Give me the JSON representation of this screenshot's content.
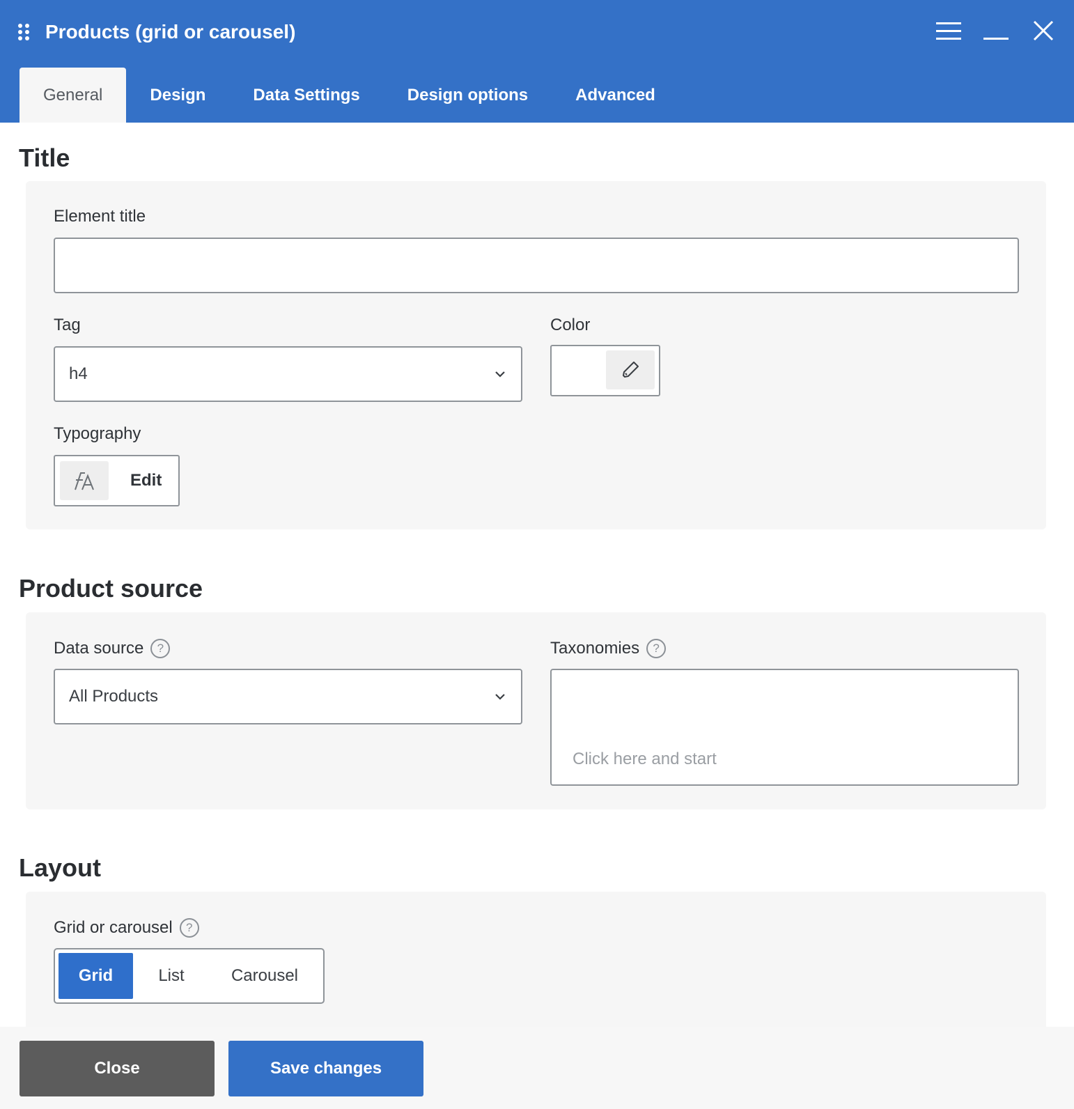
{
  "window": {
    "title": "Products (grid or carousel)",
    "icons": {
      "drag": "drag-handle-icon",
      "menu": "hamburger-menu-icon",
      "minimize": "minimize-icon",
      "close": "close-icon"
    }
  },
  "tabs": [
    {
      "label": "General",
      "active": true
    },
    {
      "label": "Design",
      "active": false
    },
    {
      "label": "Data Settings",
      "active": false
    },
    {
      "label": "Design options",
      "active": false
    },
    {
      "label": "Advanced",
      "active": false
    }
  ],
  "sections": {
    "title": {
      "heading": "Title",
      "element_title": {
        "label": "Element title",
        "value": ""
      },
      "tag": {
        "label": "Tag",
        "value": "h4"
      },
      "color": {
        "label": "Color",
        "icon": "eyedropper-icon"
      },
      "typography": {
        "label": "Typography",
        "button_label": "Edit",
        "icon": "font-typography-icon"
      }
    },
    "product_source": {
      "heading": "Product source",
      "data_source": {
        "label": "Data source",
        "value": "All Products",
        "help": "?"
      },
      "taxonomies": {
        "label": "Taxonomies",
        "placeholder": "Click here and start",
        "help": "?"
      }
    },
    "layout": {
      "heading": "Layout",
      "grid_or_carousel": {
        "label": "Grid or carousel",
        "help": "?",
        "options": [
          "Grid",
          "List",
          "Carousel"
        ],
        "selected": "Grid"
      }
    }
  },
  "footer": {
    "close_label": "Close",
    "save_label": "Save changes"
  },
  "colors": {
    "primary": "#3471c7",
    "panel_bg": "#f6f6f6",
    "close_button": "#5c5c5c"
  }
}
